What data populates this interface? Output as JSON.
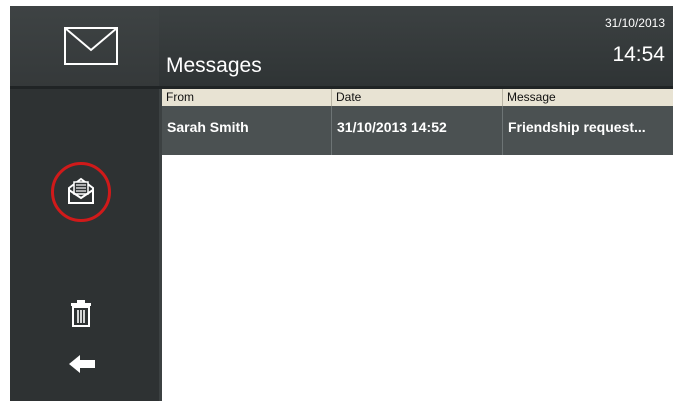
{
  "header": {
    "title": "Messages",
    "date": "31/10/2013",
    "time": "14:54"
  },
  "sidebar": {
    "icons": [
      "envelope-icon",
      "open-mail-icon",
      "trash-icon",
      "back-arrow-icon"
    ],
    "highlight_color": "#d01a1a"
  },
  "table": {
    "columns": [
      "From",
      "Date",
      "Message"
    ],
    "rows": [
      {
        "from": "Sarah Smith",
        "date": "31/10/2013 14:52",
        "message": "Friendship request..."
      }
    ]
  }
}
